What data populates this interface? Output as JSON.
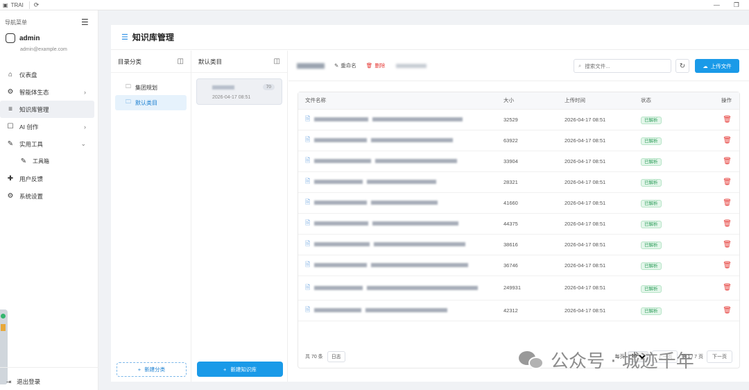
{
  "window": {
    "app_title": "TRAI"
  },
  "sidebar": {
    "nav_title": "导航菜单",
    "user": {
      "name": "admin",
      "email": "admin@example.com"
    },
    "items": [
      {
        "label": "仪表盘",
        "icon": "home-icon",
        "has_arrow": false
      },
      {
        "label": "智能体生态",
        "icon": "agent-icon",
        "has_arrow": true
      },
      {
        "label": "知识库管理",
        "icon": "database-icon",
        "has_arrow": false,
        "active": true
      },
      {
        "label": "AI 创作",
        "icon": "robot-icon",
        "has_arrow": true
      },
      {
        "label": "实用工具",
        "icon": "wrench-icon",
        "has_arrow": true,
        "expanded": true
      },
      {
        "label": "工具箱",
        "icon": "wrench-icon",
        "sub": true
      },
      {
        "label": "用户反馈",
        "icon": "feedback-icon",
        "has_arrow": false
      },
      {
        "label": "系统设置",
        "icon": "gear-icon",
        "has_arrow": false
      }
    ],
    "logout": "退出登录"
  },
  "page": {
    "title": "知识库管理"
  },
  "categories": {
    "header": "目录分类",
    "items": [
      "集团规划",
      "默认类目"
    ],
    "active_index": 1,
    "new_button": "新建分类"
  },
  "kb_list": {
    "header": "默认类目",
    "card": {
      "count": "70",
      "date": "2026-04-17 08:51"
    },
    "new_button": "新建知识库"
  },
  "toolbar": {
    "rename": "重命名",
    "delete": "删除",
    "search_placeholder": "搜索文件...",
    "upload": "上传文件"
  },
  "table": {
    "headers": [
      "文件名称",
      "大小",
      "上传时间",
      "状态",
      "操作"
    ],
    "rows": [
      {
        "size": "32529",
        "time": "2026-04-17 08:51",
        "status": "已解析"
      },
      {
        "size": "63922",
        "time": "2026-04-17 08:51",
        "status": "已解析"
      },
      {
        "size": "33904",
        "time": "2026-04-17 08:51",
        "status": "已解析"
      },
      {
        "size": "28321",
        "time": "2026-04-17 08:51",
        "status": "已解析"
      },
      {
        "size": "41660",
        "time": "2026-04-17 08:51",
        "status": "已解析"
      },
      {
        "size": "44375",
        "time": "2026-04-17 08:51",
        "status": "已解析"
      },
      {
        "size": "38616",
        "time": "2026-04-17 08:51",
        "status": "已解析"
      },
      {
        "size": "36746",
        "time": "2026-04-17 08:51",
        "status": "已解析"
      },
      {
        "size": "249931",
        "time": "2026-04-17 08:51",
        "status": "已解析",
        "tall": true
      },
      {
        "size": "42312",
        "time": "2026-04-17 08:51",
        "status": "已解析"
      }
    ]
  },
  "pagination": {
    "total": "共 70 条",
    "log": "日志",
    "per_page_label": "每页",
    "per_page": "10",
    "prev": "上一页",
    "page_info": "第 1 / 7 页",
    "next": "下一页"
  },
  "watermark": {
    "text": "公众号 · 城迹千年"
  },
  "colors": {
    "primary": "#1a9ae8",
    "danger": "#e53935",
    "success": "#2e9e5b"
  }
}
